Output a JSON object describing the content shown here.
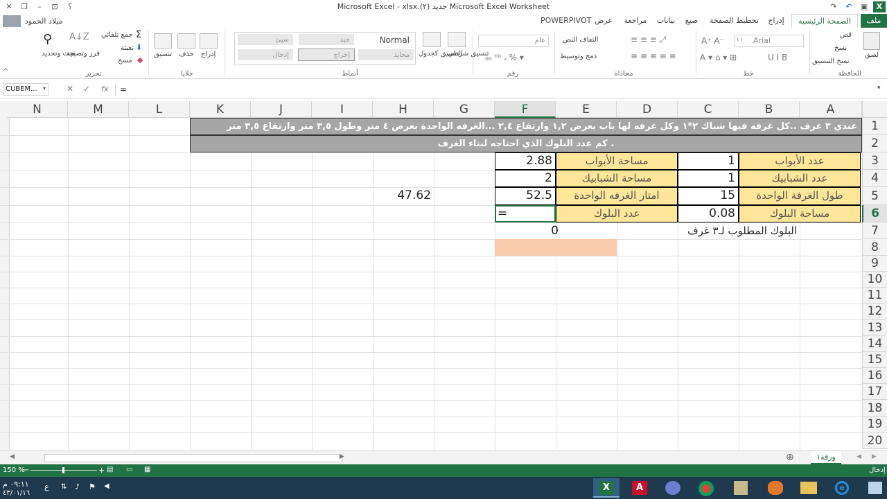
{
  "window": {
    "title": "Microsoft Excel - xlsx.(٢) جديد Microsoft Excel Worksheet",
    "help_label": "؟"
  },
  "user": {
    "name": "ميلاد الحمود"
  },
  "tabs": [
    {
      "label": "ملف"
    },
    {
      "label": "الصفحة الرئيسية"
    },
    {
      "label": "إدراج"
    },
    {
      "label": "تخطيط الصفحة"
    },
    {
      "label": "صيغ"
    },
    {
      "label": "بيانات"
    },
    {
      "label": "مراجعة"
    },
    {
      "label": "عرض"
    },
    {
      "label": "POWERPIVOT"
    }
  ],
  "ribbon": {
    "clipboard": {
      "paste": "لصق",
      "cut": "قص",
      "copy": "نسخ",
      "format_painter": "نسخ التنسيق",
      "label": "الحافظة"
    },
    "font": {
      "name": "Arial",
      "size": "١١",
      "label": "خط"
    },
    "alignment": {
      "wrap": "التفاف النص",
      "merge": "دمج وتوسيط",
      "label": "محاذاة"
    },
    "number": {
      "format": "عام",
      "label": "رقم"
    },
    "styles": {
      "conditional": "تنسيق شرطي",
      "as_table": "التنسيق كجدول",
      "normal": "Normal",
      "good": "جيد",
      "bad": "سيئ",
      "neutral": "محايد",
      "output": "إخراج",
      "input": "إدخال",
      "label": "أنماط"
    },
    "cells": {
      "insert": "إدراج",
      "delete": "حذف",
      "format": "تنسيق",
      "label": "خلايا"
    },
    "editing": {
      "autosum": "جمع تلقائي",
      "fill": "تعبئة",
      "clear": "مسح",
      "sort": "فرز وتصفية",
      "find": "بحث وتحديد",
      "label": "تحرير"
    }
  },
  "formula_bar": {
    "name_box": "CUBEM...",
    "fx": "fx",
    "content": "="
  },
  "columns": [
    "N",
    "M",
    "L",
    "K",
    "J",
    "I",
    "H",
    "G",
    "F",
    "E",
    "D",
    "C",
    "B",
    "A"
  ],
  "rows": [
    "1",
    "2",
    "3",
    "4",
    "5",
    "6",
    "7",
    "8",
    "9",
    "10",
    "11",
    "12",
    "13",
    "14",
    "15",
    "16",
    "17",
    "18",
    "19",
    "20"
  ],
  "cells": {
    "r1": "عندي ٣ غرف ..كل غرفه فيها شباك ٢*١ وكل غرفه لها باب بعرض ١,٢ وارتفاع ٢,٤ ...الغرفه الواحدة بعرض ٤ متر وطول ٣,٥ متر  وارتفاع ٣,٥ متر",
    "r2": "كم عدد البلوك الذي احتاجه لبناء الغرف  .",
    "b3": "عدد الأبواب",
    "c3": "1",
    "e3": "مساحة الأبواب",
    "f3": "2.88",
    "b4": "عدد الشبابيك",
    "c4": "1",
    "e4": "مساحة الشبابيك",
    "f4": "2",
    "b5": "طول الغرفة الواحدة",
    "c5": "15",
    "e5": "امتار الغرفه الواحدة",
    "f5": "52.5",
    "h5": "47.62",
    "b6": "مساحة البلوك",
    "c6": "0.08",
    "e6": "عدد البلوك",
    "f6": "=",
    "c7": "البلوك المطلوب لـ٣ غرف",
    "f7": "0"
  },
  "sheet_tabs": [
    {
      "label": "ورقة١"
    }
  ],
  "status": {
    "mode": "إدخال",
    "zoom": "150 %"
  },
  "taskbar": {
    "time": "٠٩:١١ م",
    "date": "٤٣/٠١/١٦",
    "lang": "ع"
  },
  "colors": {
    "excel_green": "#217346",
    "yellow_fill": "#ffe699",
    "orange_fill": "#f8cbad",
    "gray_fill": "#a6a6a6"
  }
}
